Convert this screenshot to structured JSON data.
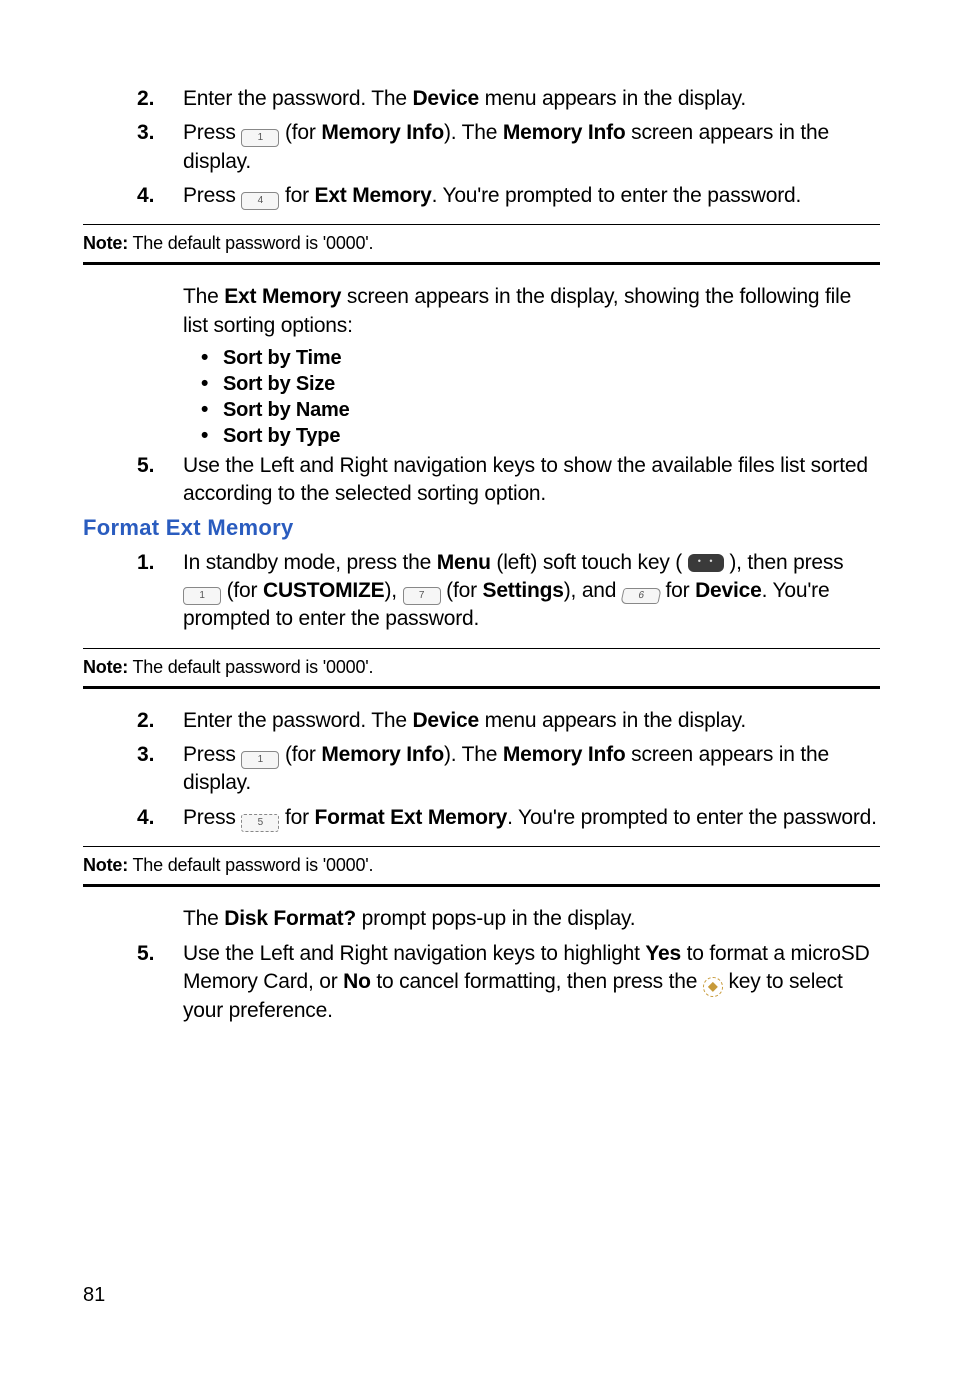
{
  "section1": {
    "steps": {
      "n2": {
        "num": "2.",
        "prefix": "Enter the password. The ",
        "b1": "Device",
        "suffix": " menu appears in the display."
      },
      "n3": {
        "num": "3.",
        "prefix": "Press ",
        "key": "1",
        "mid1": " (for ",
        "b1": "Memory Info",
        "mid2": "). The ",
        "b2": "Memory Info",
        "suffix": " screen appears in the display."
      },
      "n4": {
        "num": "4.",
        "prefix": "Press ",
        "key": "4",
        "mid1": " for ",
        "b1": "Ext Memory",
        "suffix": ". You're prompted to enter the password."
      }
    },
    "note": {
      "label": "Note:",
      "text": " The default password is '0000'."
    },
    "after_note": {
      "line": {
        "prefix": "The ",
        "b1": "Ext Memory",
        "suffix": " screen appears in the display, showing the following file list sorting options:"
      },
      "bullets": [
        "Sort by Time",
        "Sort by Size",
        "Sort by Name",
        "Sort by Type"
      ],
      "n5": {
        "num": "5.",
        "text": "Use the Left and Right navigation keys to show the available files list sorted according to the selected sorting option."
      }
    }
  },
  "heading": "Format Ext Memory",
  "section2": {
    "steps": {
      "n1": {
        "num": "1.",
        "prefix": "In standby mode, press the ",
        "b1": "Menu",
        "mid1": " (left) soft touch key ( ",
        "mid2": " ), then press ",
        "mid3": " (for ",
        "b2": "CUSTOMIZE",
        "mid4": "), ",
        "mid5": " (for ",
        "b3": "Settings",
        "mid6": "), and ",
        "mid7": " for ",
        "b4": "Device",
        "suffix": ". You're prompted to enter the password."
      }
    },
    "note1": {
      "label": "Note:",
      "text": " The default password is '0000'."
    },
    "steps2": {
      "n2": {
        "num": "2.",
        "prefix": "Enter the password. The ",
        "b1": "Device",
        "suffix": " menu appears in the display."
      },
      "n3": {
        "num": "3.",
        "prefix": "Press ",
        "key": "1",
        "mid1": " (for ",
        "b1": "Memory Info",
        "mid2": "). The ",
        "b2": "Memory Info",
        "suffix": " screen appears in the display."
      },
      "n4": {
        "num": "4.",
        "prefix": "Press ",
        "key": "5",
        "mid1": " for ",
        "b1": "Format Ext Memory",
        "suffix": ". You're prompted to enter the password."
      }
    },
    "note2": {
      "label": "Note:",
      "text": " The default password is '0000'."
    },
    "after": {
      "line": {
        "prefix": "The ",
        "b1": "Disk Format?",
        "suffix": " prompt pops-up in the display."
      },
      "n5": {
        "num": "5.",
        "prefix": "Use the Left and Right navigation keys to highlight ",
        "b1": "Yes",
        "mid1": " to format a microSD Memory Card, or ",
        "b2": "No",
        "mid2": " to cancel formatting, then press the ",
        "suffix": " key to select your preference."
      }
    }
  },
  "page": "81",
  "keys": {
    "k1": "1",
    "k4": "4",
    "k5": "5",
    "k6": "6",
    "k7": "7"
  }
}
